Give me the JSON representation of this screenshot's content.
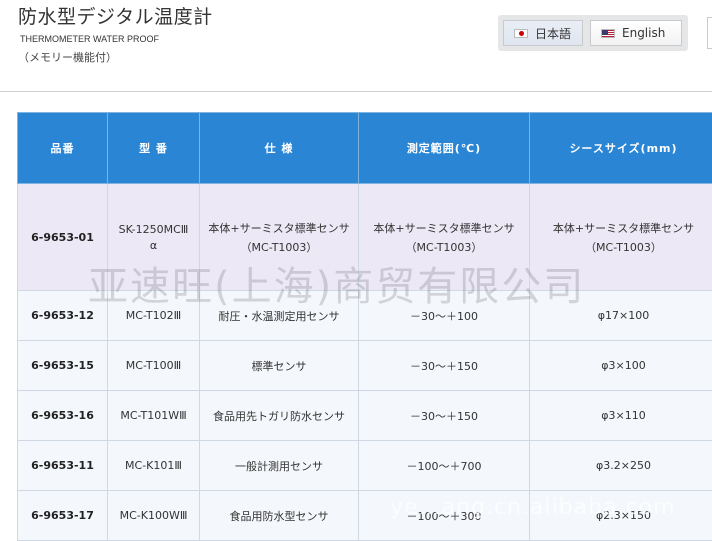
{
  "header": {
    "title": "防水型デジタル温度計",
    "subtitle": "THERMOMETER WATER PROOF",
    "memo": "（メモリー機能付）"
  },
  "language": {
    "japanese": "日本語",
    "english": "English"
  },
  "table": {
    "headers": [
      "品番",
      "型 番",
      "仕 様",
      "測定範囲(℃)",
      "シースサイズ(mm)"
    ],
    "first_row": {
      "code": "6-9653-01",
      "model_line1": "SK-1250MCⅢ",
      "model_line2": "α",
      "spec_line1": "本体+サーミスタ標準センサ",
      "spec_line2": "（MC-T1003）",
      "range_line1": "本体+サーミスタ標準センサ",
      "range_line2": "（MC-T1003）",
      "size_line1": "本体+サーミスタ標準センサ",
      "size_line2": "（MC-T1003）"
    },
    "rows": [
      {
        "code": "6-9653-12",
        "model": "MC-T102Ⅲ",
        "spec": "耐圧・水温測定用センサ",
        "range": "－30～＋100",
        "size": "φ17×100"
      },
      {
        "code": "6-9653-15",
        "model": "MC-T100Ⅲ",
        "spec": "標準センサ",
        "range": "－30～＋150",
        "size": "φ3×100"
      },
      {
        "code": "6-9653-16",
        "model": "MC-T101WⅢ",
        "spec": "食品用先トガリ防水センサ",
        "range": "－30～＋150",
        "size": "φ3×110"
      },
      {
        "code": "6-9653-11",
        "model": "MC-K101Ⅲ",
        "spec": "一般計測用センサ",
        "range": "－100～＋700",
        "size": "φ3.2×250"
      },
      {
        "code": "6-9653-17",
        "model": "MC-K100WⅢ",
        "spec": "食品用防水型センサ",
        "range": "－100～＋300",
        "size": "φ2.3×150"
      }
    ]
  },
  "watermark": {
    "main": "亚速旺(上海)商贸有限公司",
    "footer": "ye…ang.cn.alibaba.com"
  }
}
